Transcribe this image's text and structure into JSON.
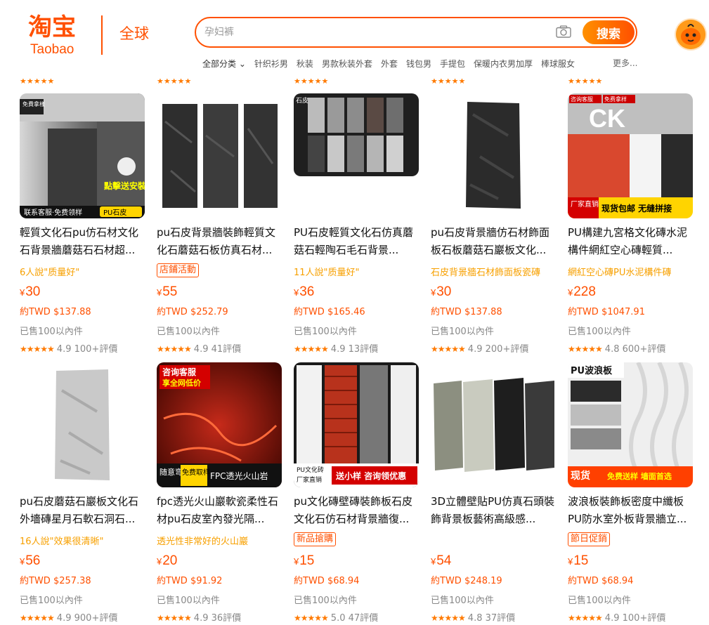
{
  "header": {
    "logo_cn": "淘宝",
    "logo_en": "Taobao",
    "region": "全球",
    "search": {
      "placeholder": "孕妇裤",
      "button_label": "搜索"
    },
    "quick_links": {
      "all_categories": "全部分类",
      "items": [
        "针织衫男",
        "秋装",
        "男款秋装外套",
        "外套",
        "钱包男",
        "手提包",
        "保暖内衣男加厚",
        "棒球服女"
      ],
      "more": "更多..."
    }
  },
  "colors": {
    "accent": "#ff5000",
    "tag": "#f7a000"
  },
  "products": [
    {
      "title": "輕質文化石pu仿石材文化石背景牆蘑菇石石材超...",
      "tag_type": "text",
      "tag": "6人說\"质量好\"",
      "price": "30",
      "currency": "¥",
      "twd": "約TWD $137.88",
      "sold": "已售100以內件",
      "stars": "★★★★★",
      "score": "4.9",
      "reviews": "100+評價"
    },
    {
      "title": "pu石皮背景牆裝飾輕質文化石蘑菇石板仿真石材...",
      "tag_type": "badge",
      "tag": "店鋪活動",
      "price": "55",
      "currency": "¥",
      "twd": "約TWD $252.79",
      "sold": "已售100以內件",
      "stars": "★★★★★",
      "score": "4.9",
      "reviews": "41評價"
    },
    {
      "title": "PU石皮輕質文化石仿真蘑菇石輕陶石毛石背景...",
      "tag_type": "text",
      "tag": "11人說\"质量好\"",
      "price": "36",
      "currency": "¥",
      "twd": "約TWD $165.46",
      "sold": "已售100以內件",
      "stars": "★★★★★",
      "score": "4.9",
      "reviews": "13評價"
    },
    {
      "title": "pu石皮背景牆仿石材飾面板石板蘑菇石巖板文化...",
      "tag_type": "text",
      "tag": "石皮背景牆石材飾面板瓷磚",
      "price": "30",
      "currency": "¥",
      "twd": "約TWD $137.88",
      "sold": "已售100以內件",
      "stars": "★★★★★",
      "score": "4.9",
      "reviews": "200+評價"
    },
    {
      "title": "PU構建九宮格文化磚水泥構件網紅空心磚輕質...",
      "tag_type": "text",
      "tag": "網紅空心磚PU水泥構件磚",
      "price": "228",
      "currency": "¥",
      "twd": "約TWD $1047.91",
      "sold": "已售100以內件",
      "stars": "★★★★★",
      "score": "4.8",
      "reviews": "600+評價"
    },
    {
      "title": "pu石皮蘑菇石巖板文化石外墻磚星月石軟石洞石...",
      "tag_type": "text",
      "tag": "16人說\"效果很清晰\"",
      "price": "56",
      "currency": "¥",
      "twd": "約TWD $257.38",
      "sold": "已售100以內件",
      "stars": "★★★★★",
      "score": "4.9",
      "reviews": "900+評價"
    },
    {
      "title": "fpc透光火山巖軟瓷柔性石材pu石皮室內發光隔...",
      "tag_type": "text",
      "tag": "透光性非常好的火山巖",
      "price": "20",
      "currency": "¥",
      "twd": "約TWD $91.92",
      "sold": "已售100以內件",
      "stars": "★★★★★",
      "score": "4.9",
      "reviews": "36評價"
    },
    {
      "title": "pu文化磚壁磚裝飾板石皮文化石仿石材背景牆復...",
      "tag_type": "badge",
      "tag": "新品搶購",
      "price": "15",
      "currency": "¥",
      "twd": "約TWD $68.94",
      "sold": "已售100以內件",
      "stars": "★★★★★",
      "score": "5.0",
      "reviews": "47評價"
    },
    {
      "title": "3D立體壁貼PU仿真石頭裝飾背景板藝術高級感...",
      "tag_type": "none",
      "tag": "",
      "price": "54",
      "currency": "¥",
      "twd": "約TWD $248.19",
      "sold": "已售100以內件",
      "stars": "★★★★★",
      "score": "4.8",
      "reviews": "37評價"
    },
    {
      "title": "波浪板裝飾板密度中纖板PU防水室外板背景牆立...",
      "tag_type": "badge",
      "tag": "節日促銷",
      "price": "15",
      "currency": "¥",
      "twd": "約TWD $68.94",
      "sold": "已售100以內件",
      "stars": "★★★★★",
      "score": "4.9",
      "reviews": "100+評價"
    }
  ],
  "image_overlays": {
    "p1_top": "免費拿樣",
    "p1_corner": "點擊送安裝工具",
    "p1_bottom": "联系客服·免费领样",
    "p1_tag": "PU石皮",
    "p3_corner": "石皮",
    "p5_top": "咨询客服",
    "p5_top2": "免费拿样",
    "p5_letters": "CK",
    "p5_b1": "厂家直销",
    "p5_b2": "现货包邮 无缝拼接",
    "p7_top": "咨询客服",
    "p7_top2": "享全网低价",
    "p7_b1": "随意弯曲",
    "p7_b2": "免费取样",
    "p7_b3": "FPC透光火山岩",
    "p8_b1": "PU文化砖",
    "p8_b2": "厂家直销",
    "p8_b3": "送小样 咨询领优惠",
    "p10_top": "PU波浪板",
    "p10_b1": "现货",
    "p10_b2": "免费送样 墙面首选"
  }
}
